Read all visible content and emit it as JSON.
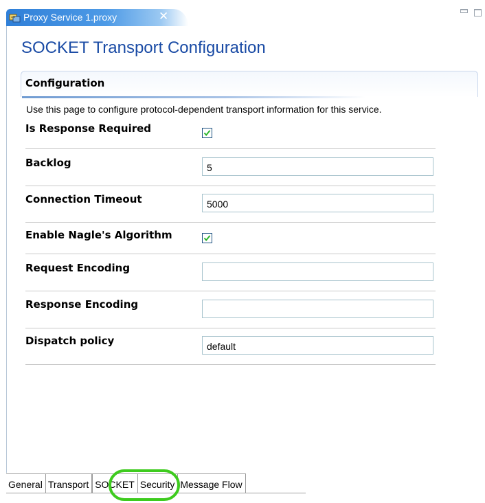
{
  "editor_tab": {
    "title": "Proxy Service 1.proxy",
    "close_glyph": "✕",
    "icon": "proxy-service-icon"
  },
  "window_controls": {
    "minimize_icon": "minimize-icon",
    "maximize_icon": "maximize-icon"
  },
  "page": {
    "title": "SOCKET Transport Configuration"
  },
  "section": {
    "title": "Configuration",
    "description": "Use this page to configure protocol-dependent transport information for this service."
  },
  "fields": [
    {
      "label": "Is Response Required",
      "type": "checkbox",
      "checked": true
    },
    {
      "label": "Backlog",
      "type": "text",
      "value": "5"
    },
    {
      "label": "Connection Timeout",
      "type": "text",
      "value": "5000"
    },
    {
      "label": "Enable Nagle's Algorithm",
      "type": "checkbox",
      "checked": true
    },
    {
      "label": "Request Encoding",
      "type": "text",
      "value": ""
    },
    {
      "label": "Response Encoding",
      "type": "text",
      "value": ""
    },
    {
      "label": "Dispatch policy",
      "type": "text",
      "value": "default"
    }
  ],
  "bottom_tabs": [
    {
      "label": "General",
      "active": false
    },
    {
      "label": "Transport",
      "active": false
    },
    {
      "label": "SOCKET",
      "active": true
    },
    {
      "label": "Security",
      "active": false
    },
    {
      "label": "Message Flow",
      "active": false
    }
  ],
  "colors": {
    "title_blue": "#1a4ba5",
    "tab_gradient_start": "#2f7fd8",
    "highlight_ring": "#3ecb1e",
    "checkmark_green": "#2bb52b"
  }
}
